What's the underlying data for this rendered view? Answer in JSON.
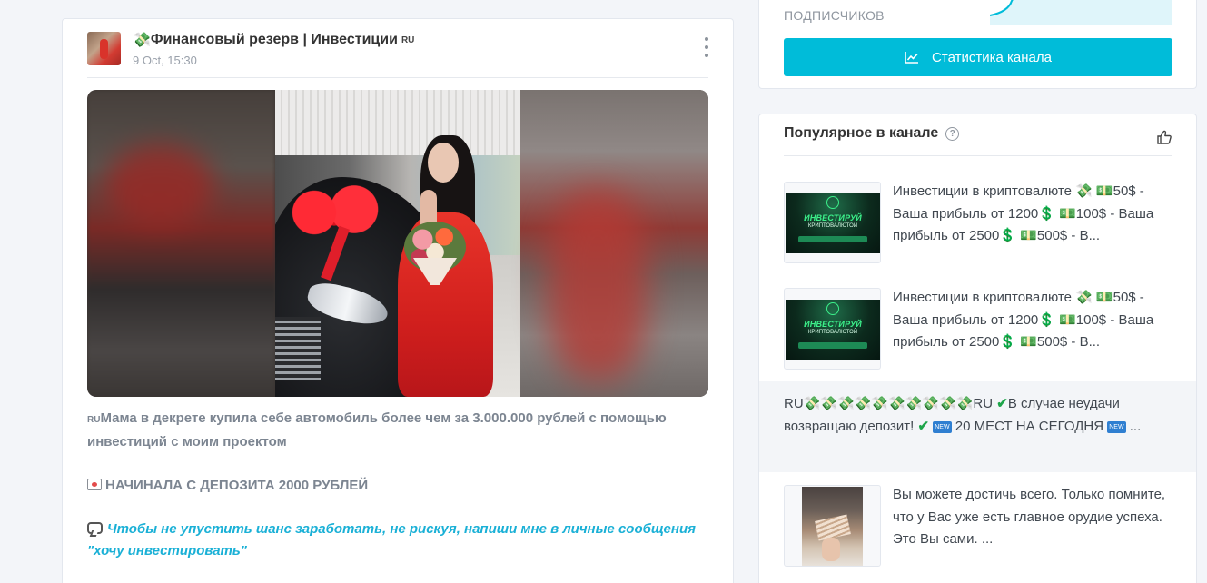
{
  "post": {
    "channel_emoji": "💸",
    "channel_name": "Финансовый резерв | Инвестиции",
    "channel_flag": "RU",
    "date": "9 Oct, 15:30",
    "text_flag": "RU",
    "text_main": "Мама в декрете купила себе автомобиль более чем за 3.000.000 рублей с помощью инвестиций с моим проектом",
    "text_deposit": "НАЧИНАЛА С ДЕПОЗИТА 2000 РУБЛЕЙ",
    "text_cta": "Чтобы не упустить шанс заработать, не рискуя, напиши мне в личные сообщения \"хочу инвестировать\""
  },
  "stats": {
    "subscribers_label": "ПОДПИСЧИКОВ",
    "button_label": "Статистика канала",
    "accent_color": "#00bcd9"
  },
  "popular": {
    "title": "Популярное в канале",
    "items": [
      {
        "banner_title": "ИНВЕСТИРУЙ",
        "banner_sub": "КРИПТОВАЛЮТОЙ",
        "text": "Инвестиции в криптовалюте 💸 💵50$ - Ваша прибыль от 1200💲 💵100$ - Ваша прибыль от 2500💲 💵500$ - В..."
      },
      {
        "banner_title": "ИНВЕСТИРУЙ",
        "banner_sub": "КРИПТОВАЛЮТОЙ",
        "text": "Инвестиции в криптовалюте 💸 💵50$ - Ваша прибыль от 1200💲 💵100$ - Ваша прибыль от 2500💲 💵500$ - В..."
      },
      {
        "prefix": "RU💸💸💸💸💸💸💸💸💸💸RU",
        "part1": "В случае неудачи возвращаю депозит!",
        "part2": "20 МЕСТ НА СЕГОДНЯ",
        "ellipsis": "...",
        "new_badge": "NEW"
      },
      {
        "text": "Вы можете достичь всего. Только помните, что у Вас уже есть главное орудие успеха. Это Вы сами. ..."
      }
    ]
  }
}
